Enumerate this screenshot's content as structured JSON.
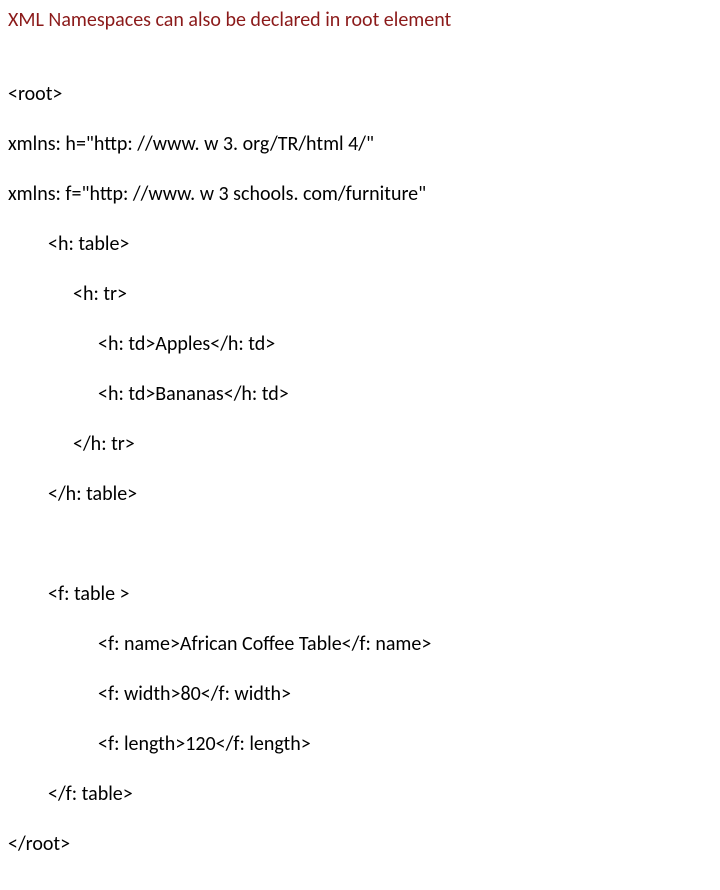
{
  "heading": "XML Namespaces can also be declared in root element",
  "code": {
    "l1": "<root>",
    "l2": "xmlns: h=\"http: //www. w 3. org/TR/html 4/\"",
    "l3": "xmlns: f=\"http: //www. w 3 schools. com/furniture\"",
    "l4": "<h: table>",
    "l5": "<h: tr>",
    "l6": "<h: td>Apples</h: td>",
    "l7": "<h: td>Bananas</h: td>",
    "l8": "</h: tr>",
    "l9": "</h: table>",
    "l10": "<f: table >",
    "l11": "<f: name>African Coffee Table</f: name>",
    "l12": "<f: width>80</f: width>",
    "l13": "<f: length>120</f: length>",
    "l14": "</f: table>",
    "l15": "</root>"
  }
}
